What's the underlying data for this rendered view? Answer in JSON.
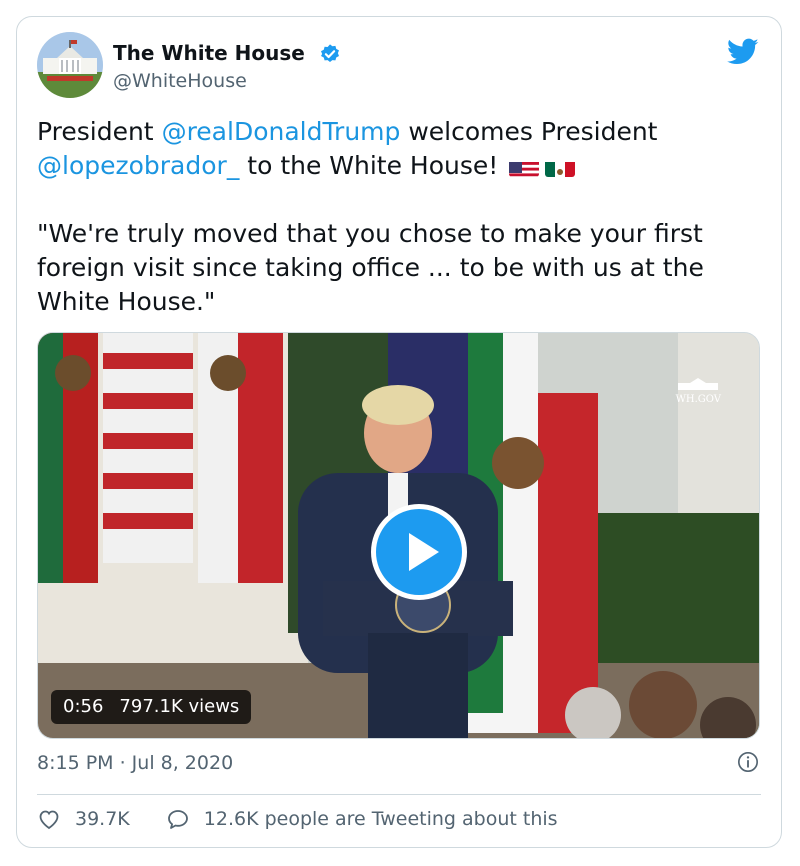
{
  "tweet": {
    "author": {
      "name": "The White House",
      "handle": "@WhiteHouse"
    },
    "text": {
      "p1": "President ",
      "m1": "@realDonaldTrump",
      "p2": " welcomes President",
      "m2": "@lopezobrador_",
      "p3": " to the White House! ",
      "quote": "\"We're truly moved that you chose to make your first foreign visit since taking office ... to be with us at the White House.\""
    },
    "media": {
      "duration": "0:56",
      "views": "797.1K views",
      "watermark": "WH.GOV"
    },
    "timestamp": "8:15 PM · Jul 8, 2020",
    "likes": "39.7K",
    "conversation": "12.6K people are Tweeting about this"
  },
  "icons": [
    "avatar-image",
    "verified-badge-icon",
    "twitter-bird-icon",
    "us-flag-icon",
    "mexico-flag-icon",
    "play-icon",
    "info-icon",
    "heart-icon",
    "reply-icon"
  ],
  "colors": {
    "link": "#1b95e0",
    "play": "#1d9bf0",
    "muted": "#536471",
    "border": "#cfd9de"
  }
}
